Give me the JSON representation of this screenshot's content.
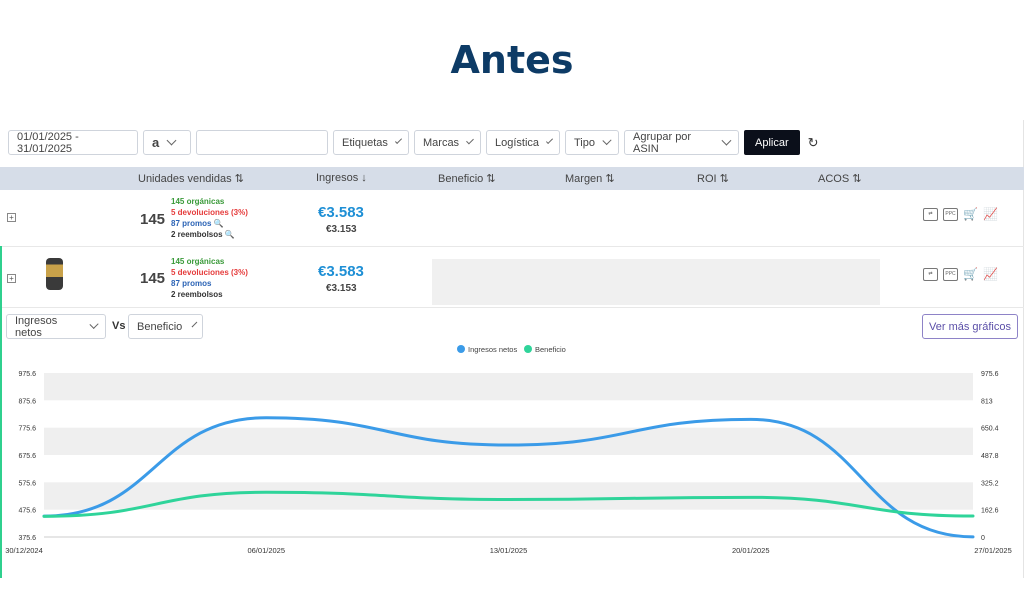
{
  "heading": "Antes",
  "filters": {
    "date_range": "01/01/2025 - 31/01/2025",
    "marketplace_icon": "a",
    "search_value": "",
    "tags": "Etiquetas",
    "brands": "Marcas",
    "logistics": "Logística",
    "type": "Tipo",
    "group_by": "Agrupar por ASIN",
    "apply": "Aplicar",
    "reset_icon": "↻"
  },
  "table": {
    "headers": [
      "Unidades vendidas ⇅",
      "Ingresos ↓",
      "Beneficio ⇅",
      "Margen ⇅",
      "ROI ⇅",
      "ACOS ⇅"
    ],
    "rows": [
      {
        "units": "145",
        "organic": "145 orgánicas",
        "returns": "5 devoluciones (3%)",
        "promos": "87 promos 🔍",
        "refunds": "2 reembolsos 🔍",
        "revenue": "€3.583",
        "revenue_sub": "€3.153"
      },
      {
        "units": "145",
        "organic": "145 orgánicas",
        "returns": "5 devoluciones (3%)",
        "promos": "87 promos",
        "refunds": "2 reembolsos",
        "revenue": "€3.583",
        "revenue_sub": "€3.153"
      }
    ],
    "row_icons": [
      "compare-icon",
      "ppc-icon",
      "cart-icon",
      "chart-icon"
    ],
    "ppc_text": "PPC"
  },
  "chart_controls": {
    "left_metric": "Ingresos netos",
    "vs": "Vs",
    "right_metric": "Beneficio",
    "more_button": "Ver más gráficos"
  },
  "chart_data": {
    "type": "line",
    "x": [
      "30/12/2024",
      "06/01/2025",
      "13/01/2025",
      "20/01/2025",
      "27/01/2025"
    ],
    "series": [
      {
        "name": "Ingresos netos",
        "color": "#3b9be8",
        "axis": "left",
        "values": [
          452,
          812,
          712,
          806,
          376
        ]
      },
      {
        "name": "Beneficio",
        "color": "#2fd49a",
        "axis": "right",
        "values": [
          123,
          266,
          223,
          236,
          125
        ]
      }
    ],
    "left_ticks": [
      "975.6",
      "875.6",
      "775.6",
      "675.6",
      "575.6",
      "475.6",
      "375.6"
    ],
    "right_ticks": [
      "975.6",
      "813",
      "650.4",
      "487.8",
      "325.2",
      "162.6",
      "0"
    ],
    "ylim_left": [
      375.6,
      975.6
    ],
    "ylim_right": [
      0,
      975.6
    ],
    "legend": "top-center",
    "grid": true
  }
}
